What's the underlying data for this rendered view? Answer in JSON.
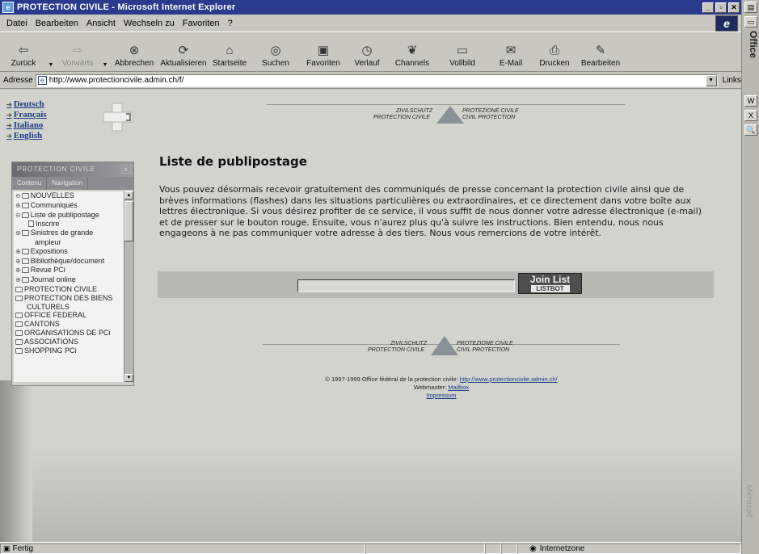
{
  "window": {
    "title": "PROTECTION CIVILE - Microsoft Internet Explorer",
    "controls": [
      "_",
      "▫",
      "✕"
    ]
  },
  "menu": [
    "Datei",
    "Bearbeiten",
    "Ansicht",
    "Wechseln zu",
    "Favoriten",
    "?"
  ],
  "toolbar": {
    "back": "Zurück",
    "forward": "Vorwärts",
    "stop": "Abbrechen",
    "refresh": "Aktualisieren",
    "home": "Startseite",
    "search": "Suchen",
    "favorites": "Favoriten",
    "history": "Verlauf",
    "channels": "Channels",
    "fullscreen": "Vollbild",
    "mail": "E-Mail",
    "print": "Drucken",
    "edit": "Bearbeiten"
  },
  "address": {
    "label": "Adresse",
    "url": "http://www.protectioncivile.admin.ch/f/",
    "links": "Links"
  },
  "languages": [
    "Deutsch",
    "Français",
    "Italiano",
    "English"
  ],
  "banner": {
    "left_line1": "ZIVILSCHUTZ",
    "left_line2": "PROTECTION CIVILE",
    "right_line1": "PROTEZIONE CIVILE",
    "right_line2": "CIVIL PROTECTION"
  },
  "nav": {
    "header": "PROTECTION CIVILE",
    "tabs": [
      "Contenu",
      "Navigation"
    ],
    "close": "x",
    "items": [
      {
        "label": "NOUVELLES"
      },
      {
        "label": "Communiqués"
      },
      {
        "label": "Liste de publipostage"
      },
      {
        "label": "Inscrire"
      },
      {
        "label": "Sinistres de grande"
      },
      {
        "label": "ampleur"
      },
      {
        "label": "Expositions"
      },
      {
        "label": "Bibliothèque/document"
      },
      {
        "label": "Revue PCi"
      },
      {
        "label": "Journal online"
      },
      {
        "label": "PROTECTION CIVILE"
      },
      {
        "label": "PROTECTION DES BIENS"
      },
      {
        "label": "CULTURELS"
      },
      {
        "label": "OFFICE FEDERAL"
      },
      {
        "label": "CANTONS"
      },
      {
        "label": "ORGANISATIONS DE PCi"
      },
      {
        "label": "ASSOCIATIONS"
      },
      {
        "label": "SHOPPING PCi"
      }
    ]
  },
  "main": {
    "title": "Liste de publipostage",
    "intro": "Vous pouvez désormais recevoir gratuitement des communiqués de presse concernant la protection civile ainsi que de brèves informations (flashes) dans les situations particulières ou extraordinaires, et ce directement dans votre boîte aux lettres électronique. Si vous désirez profiter de ce service, il vous suffit de nous donner votre adresse électronique (e-mail) et de presser sur le bouton rouge. Ensuite, vous n'aurez plus qu'à suivre les instructions. Bien entendu, nous nous engageons à ne pas communiquer votre adresse à des tiers. Nous vous remercions de votre intérêt.",
    "email_value": "",
    "join_line1": "Join List",
    "join_line2": "LISTBOT"
  },
  "footer": {
    "copyright": "© 1997-1999  Office fédéral de la protection civile:",
    "copyright_link": "http://www.protectioncivile.admin.ch/",
    "webmaster_label": "Webmaster:",
    "webmaster_link": "Mailbox",
    "impressum": "Impressum"
  },
  "status": {
    "text": "Fertig",
    "zone": "Internetzone"
  },
  "office_bar": {
    "label": "Office",
    "brand": "Microsoft"
  },
  "colors": {
    "titlebar": "#2a3a8c",
    "link": "#1d3d8a",
    "content_bg": "#d3d3ce"
  }
}
